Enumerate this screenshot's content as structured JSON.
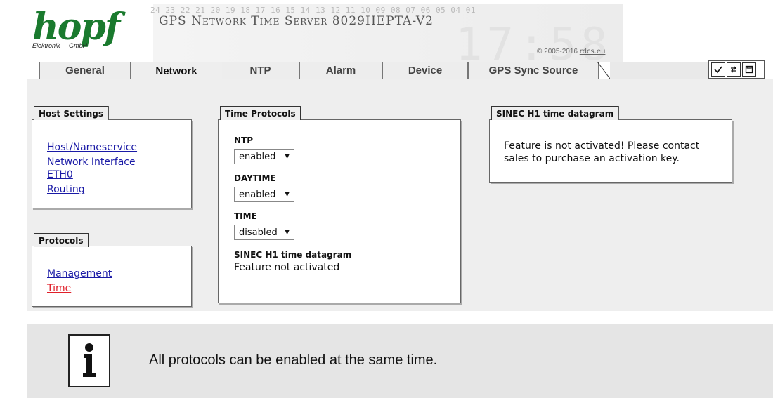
{
  "header": {
    "logo": "hopf",
    "logo_sub": "Elektronik     GmbH",
    "scale_digits": "24 23 22 21 20 19 18 17 16 15 14 13 12 11 10 09 08 07 06 05 04 01",
    "title": "GPS Network Time Server 8029HEPTA-V2",
    "copyright_prefix": "© 2005-2016 ",
    "copyright_link": "rdcs.eu"
  },
  "tabs": [
    {
      "label": "General"
    },
    {
      "label": "Network"
    },
    {
      "label": "NTP"
    },
    {
      "label": "Alarm"
    },
    {
      "label": "Device"
    },
    {
      "label": "GPS Sync Source"
    }
  ],
  "toolbar": {
    "icons": [
      "check-icon",
      "refresh-icon",
      "save-icon"
    ]
  },
  "host_settings": {
    "title": "Host Settings",
    "links": [
      "Host/Nameservice",
      "Network Interface",
      "ETH0",
      "Routing"
    ]
  },
  "protocols": {
    "title": "Protocols",
    "links": [
      "Management",
      "Time"
    ]
  },
  "time_protocols": {
    "title": "Time Protocols",
    "ntp_label": "NTP",
    "ntp_value": "enabled",
    "daytime_label": "DAYTIME",
    "daytime_value": "enabled",
    "time_label": "TIME",
    "time_value": "disabled",
    "sinec_label": "SINEC H1 time datagram",
    "sinec_value": "Feature not activated"
  },
  "sinec_panel": {
    "title": "SINEC H1 time datagram",
    "message_line1": "Feature is not activated! Please contact",
    "message_line2": "sales to purchase an activation key."
  },
  "note": {
    "icon": "info-icon",
    "text": "All protocols can be enabled at the same time."
  },
  "colors": {
    "logo": "#1a7a2e",
    "link": "#1a1aa6",
    "active_link": "#e0202a",
    "content_bg": "#eeeeee"
  }
}
